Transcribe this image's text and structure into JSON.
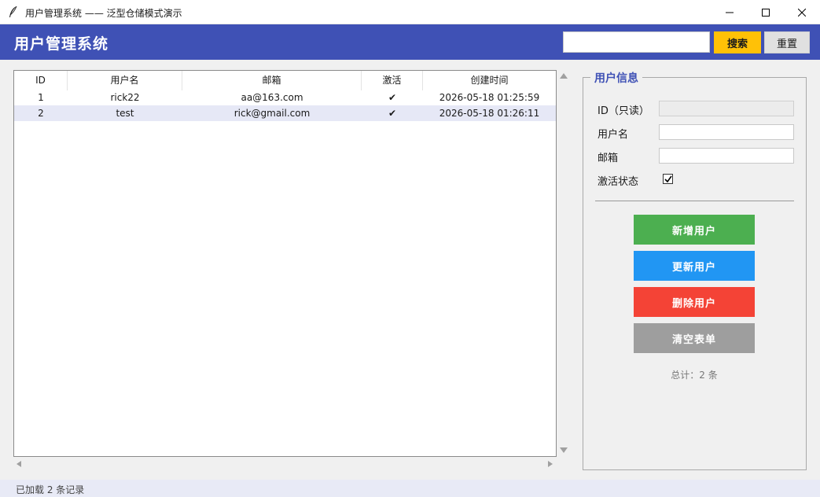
{
  "window": {
    "title": "用户管理系统 —— 泛型仓储模式演示"
  },
  "header": {
    "title": "用户管理系统",
    "search_value": "",
    "search_button": "搜索",
    "reset_button": "重置"
  },
  "table": {
    "columns": [
      "ID",
      "用户名",
      "邮箱",
      "激活",
      "创建时间"
    ],
    "rows": [
      {
        "id": "1",
        "username": "rick22",
        "email": "aa@163.com",
        "active": "✔",
        "created": "2026-05-18 01:25:59"
      },
      {
        "id": "2",
        "username": "test",
        "email": "rick@gmail.com",
        "active": "✔",
        "created": "2026-05-18 01:26:11"
      }
    ],
    "selected_row": 2
  },
  "form": {
    "title": "用户信息",
    "id_label": "ID（只读）",
    "id_value": "",
    "username_label": "用户名",
    "username_value": "",
    "email_label": "邮箱",
    "email_value": "",
    "active_label": "激活状态",
    "active_checked": true
  },
  "actions": {
    "add": "新增用户",
    "update": "更新用户",
    "delete": "删除用户",
    "clear": "清空表单"
  },
  "total_text": "总计：2 条",
  "status": {
    "text": "已加载 2 条记录"
  },
  "colors": {
    "header": "#3f51b5",
    "search": "#ffc107",
    "add": "#4caf50",
    "update": "#2196f3",
    "delete": "#f44336",
    "clear": "#9e9e9e",
    "selected_row": "#e6e8f6"
  },
  "icons": {
    "app": "feather-icon",
    "minimize": "minimize-icon",
    "maximize": "maximize-icon",
    "close": "close-icon",
    "checkbox": "checkmark-icon"
  }
}
